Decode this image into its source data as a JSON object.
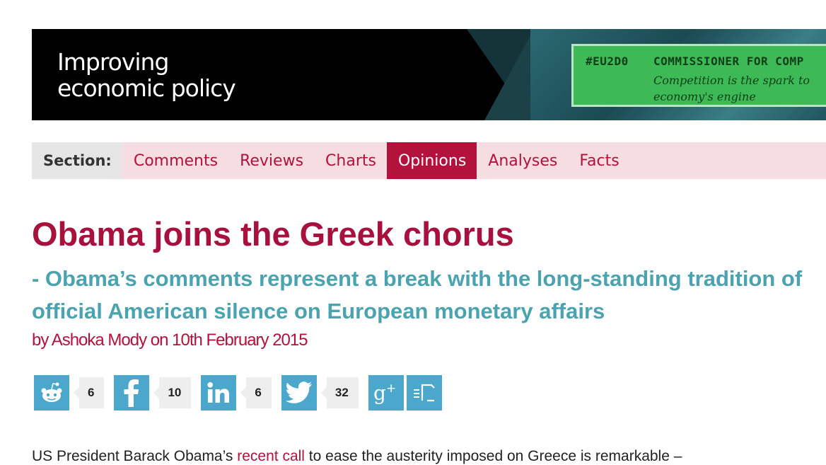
{
  "banner": {
    "title_line1": "Improving",
    "title_line2": "economic policy",
    "promo": {
      "tag": "#EU2D0",
      "heading": "COMMISSIONER FOR COMP",
      "subline1": "Competition is the spark to",
      "subline2": "economy's engine"
    }
  },
  "section_nav": {
    "label": "Section:",
    "items": [
      {
        "label": "Comments",
        "active": false
      },
      {
        "label": "Reviews",
        "active": false
      },
      {
        "label": "Charts",
        "active": false
      },
      {
        "label": "Opinions",
        "active": true
      },
      {
        "label": "Analyses",
        "active": false
      },
      {
        "label": "Facts",
        "active": false
      }
    ]
  },
  "article": {
    "title": "Obama joins the Greek chorus",
    "subtitle": "- Obama’s comments represent a break with the long-standing tradition of official American silence on European monetary affairs",
    "byline": "by Ashoka Mody on 10th February 2015",
    "body": {
      "before_link": "US President Barack Obama’s ",
      "link": "recent call",
      "after_link": " to ease the austerity imposed on Greece is remarkable –"
    }
  },
  "share": {
    "reddit_icon": "reddit-icon",
    "reddit_count": "6",
    "facebook_icon": "facebook-icon",
    "facebook_count": "10",
    "linkedin_icon": "linkedin-icon",
    "linkedin_count": "6",
    "twitter_icon": "twitter-icon",
    "twitter_count": "32",
    "googleplus_icon": "google-plus-icon",
    "buffer_icon": "buffer-icon"
  },
  "colors": {
    "accent": "#b3123c",
    "title": "#a8113d",
    "subtitle": "#4ba3b0",
    "share_button": "#4ba7cc",
    "nav_background": "#f5dde2",
    "promo_green": "#3dba55"
  }
}
